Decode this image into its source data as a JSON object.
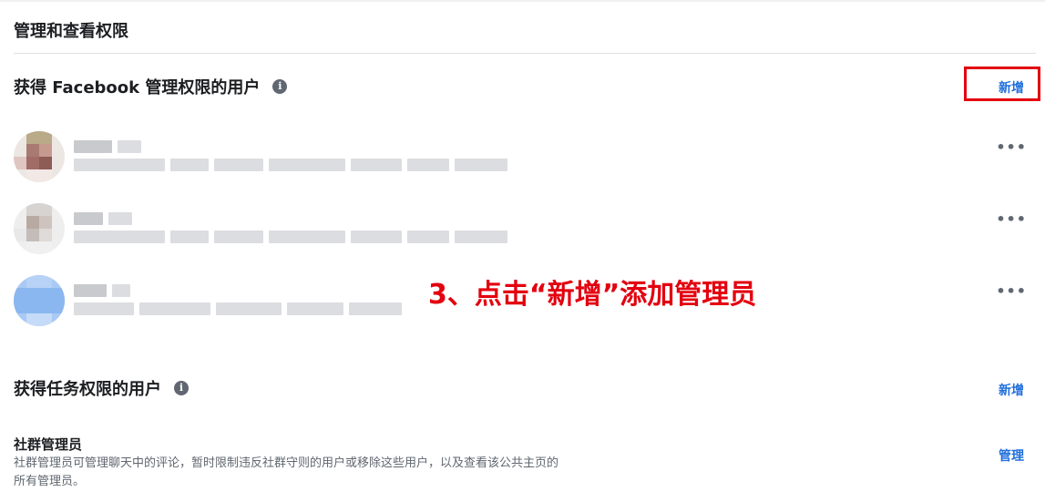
{
  "page": {
    "title": "管理和查看权限"
  },
  "fb_section": {
    "title": "获得 Facebook 管理权限的用户",
    "info_icon": "info-icon",
    "add_label": "新增"
  },
  "users": [
    {
      "more_label": "•••"
    },
    {
      "more_label": "•••"
    },
    {
      "more_label": "•••"
    }
  ],
  "annotation": {
    "text": "3、点击“新增”添加管理员",
    "color": "#e3000f"
  },
  "task_section": {
    "title": "获得任务权限的用户",
    "info_icon": "info-icon",
    "add_label": "新增"
  },
  "community_role": {
    "title": "社群管理员",
    "description": "社群管理员可管理聊天中的评论，暂时限制违反社群守则的用户或移除这些用户，以及查看该公共主页的所有管理员。",
    "manage_label": "管理"
  },
  "colors": {
    "link": "#216fdb",
    "highlight": "#e3000f",
    "text": "#1c1e21",
    "secondary": "#606770"
  }
}
